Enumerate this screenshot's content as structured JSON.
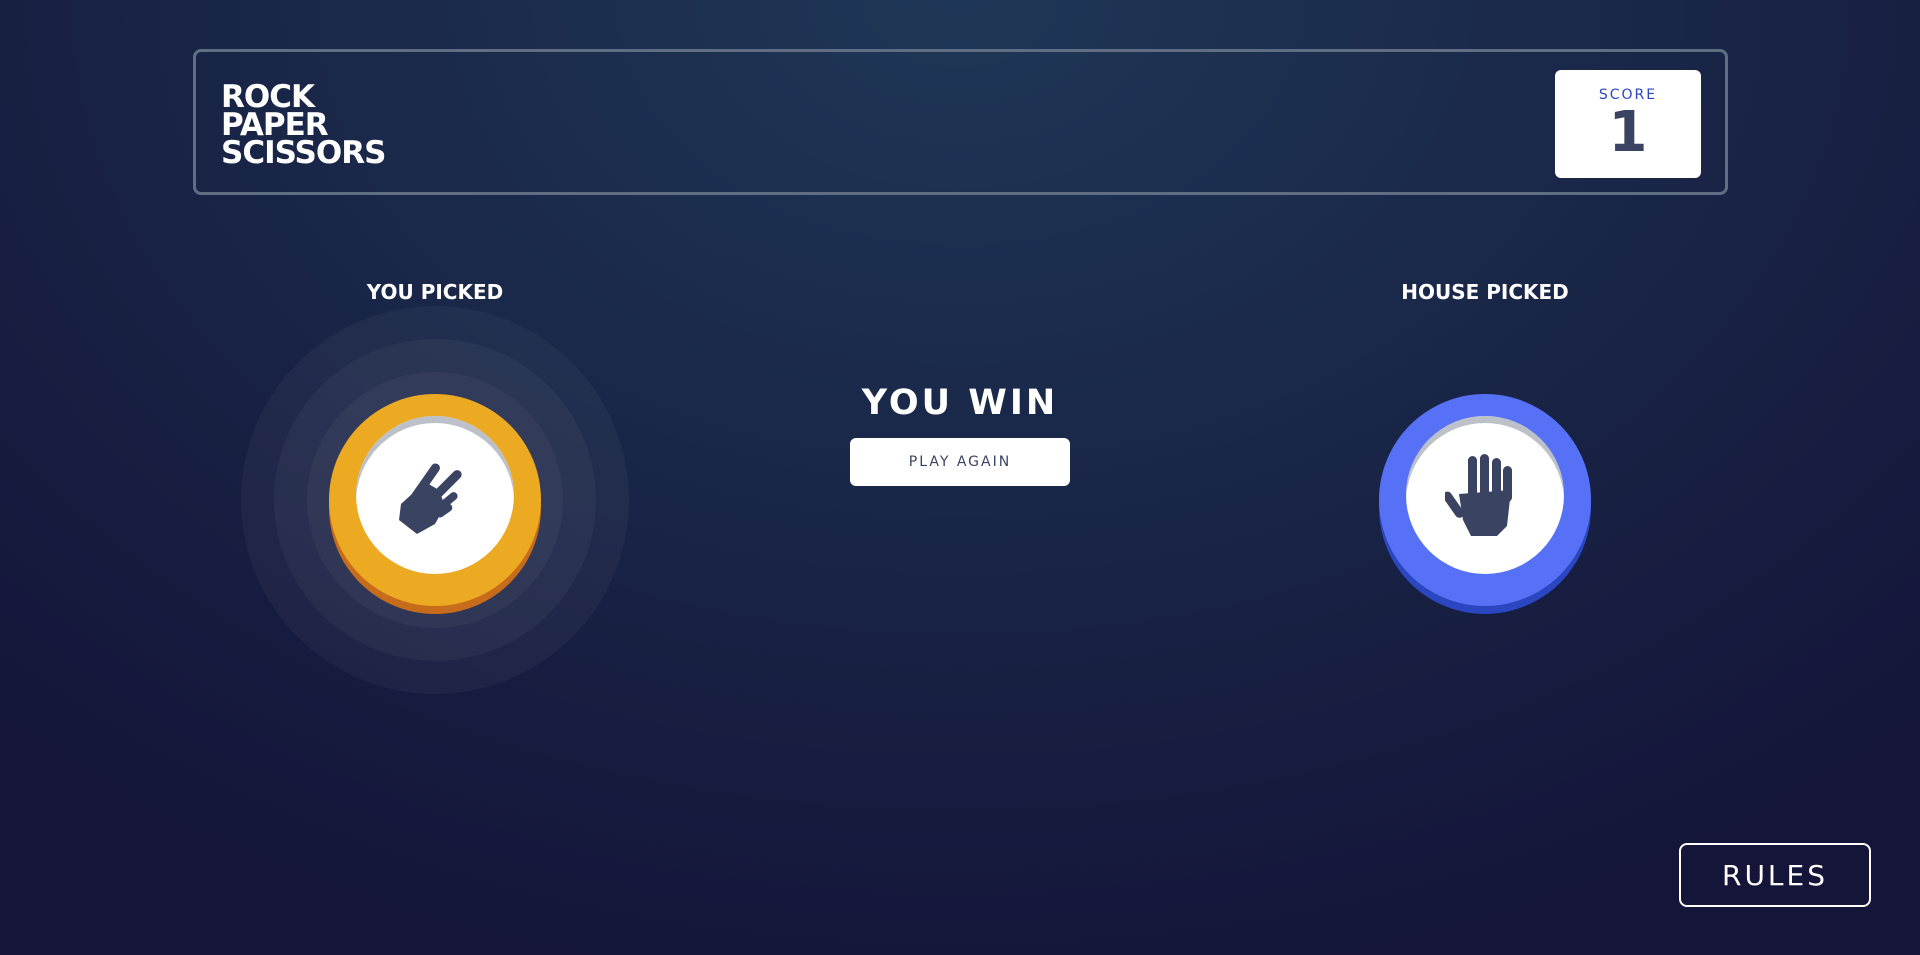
{
  "header": {
    "title_lines": [
      "ROCK",
      "PAPER",
      "SCISSORS"
    ],
    "score_label": "SCORE",
    "score_value": "1"
  },
  "player": {
    "label": "YOU PICKED",
    "choice": "scissors",
    "icon": "scissors-hand-icon",
    "color": "#eca922"
  },
  "house": {
    "label": "HOUSE PICKED",
    "choice": "paper",
    "icon": "paper-hand-icon",
    "color": "#5671f5"
  },
  "result": {
    "text": "YOU WIN",
    "play_again_label": "PLAY AGAIN"
  },
  "footer": {
    "rules_label": "RULES"
  }
}
